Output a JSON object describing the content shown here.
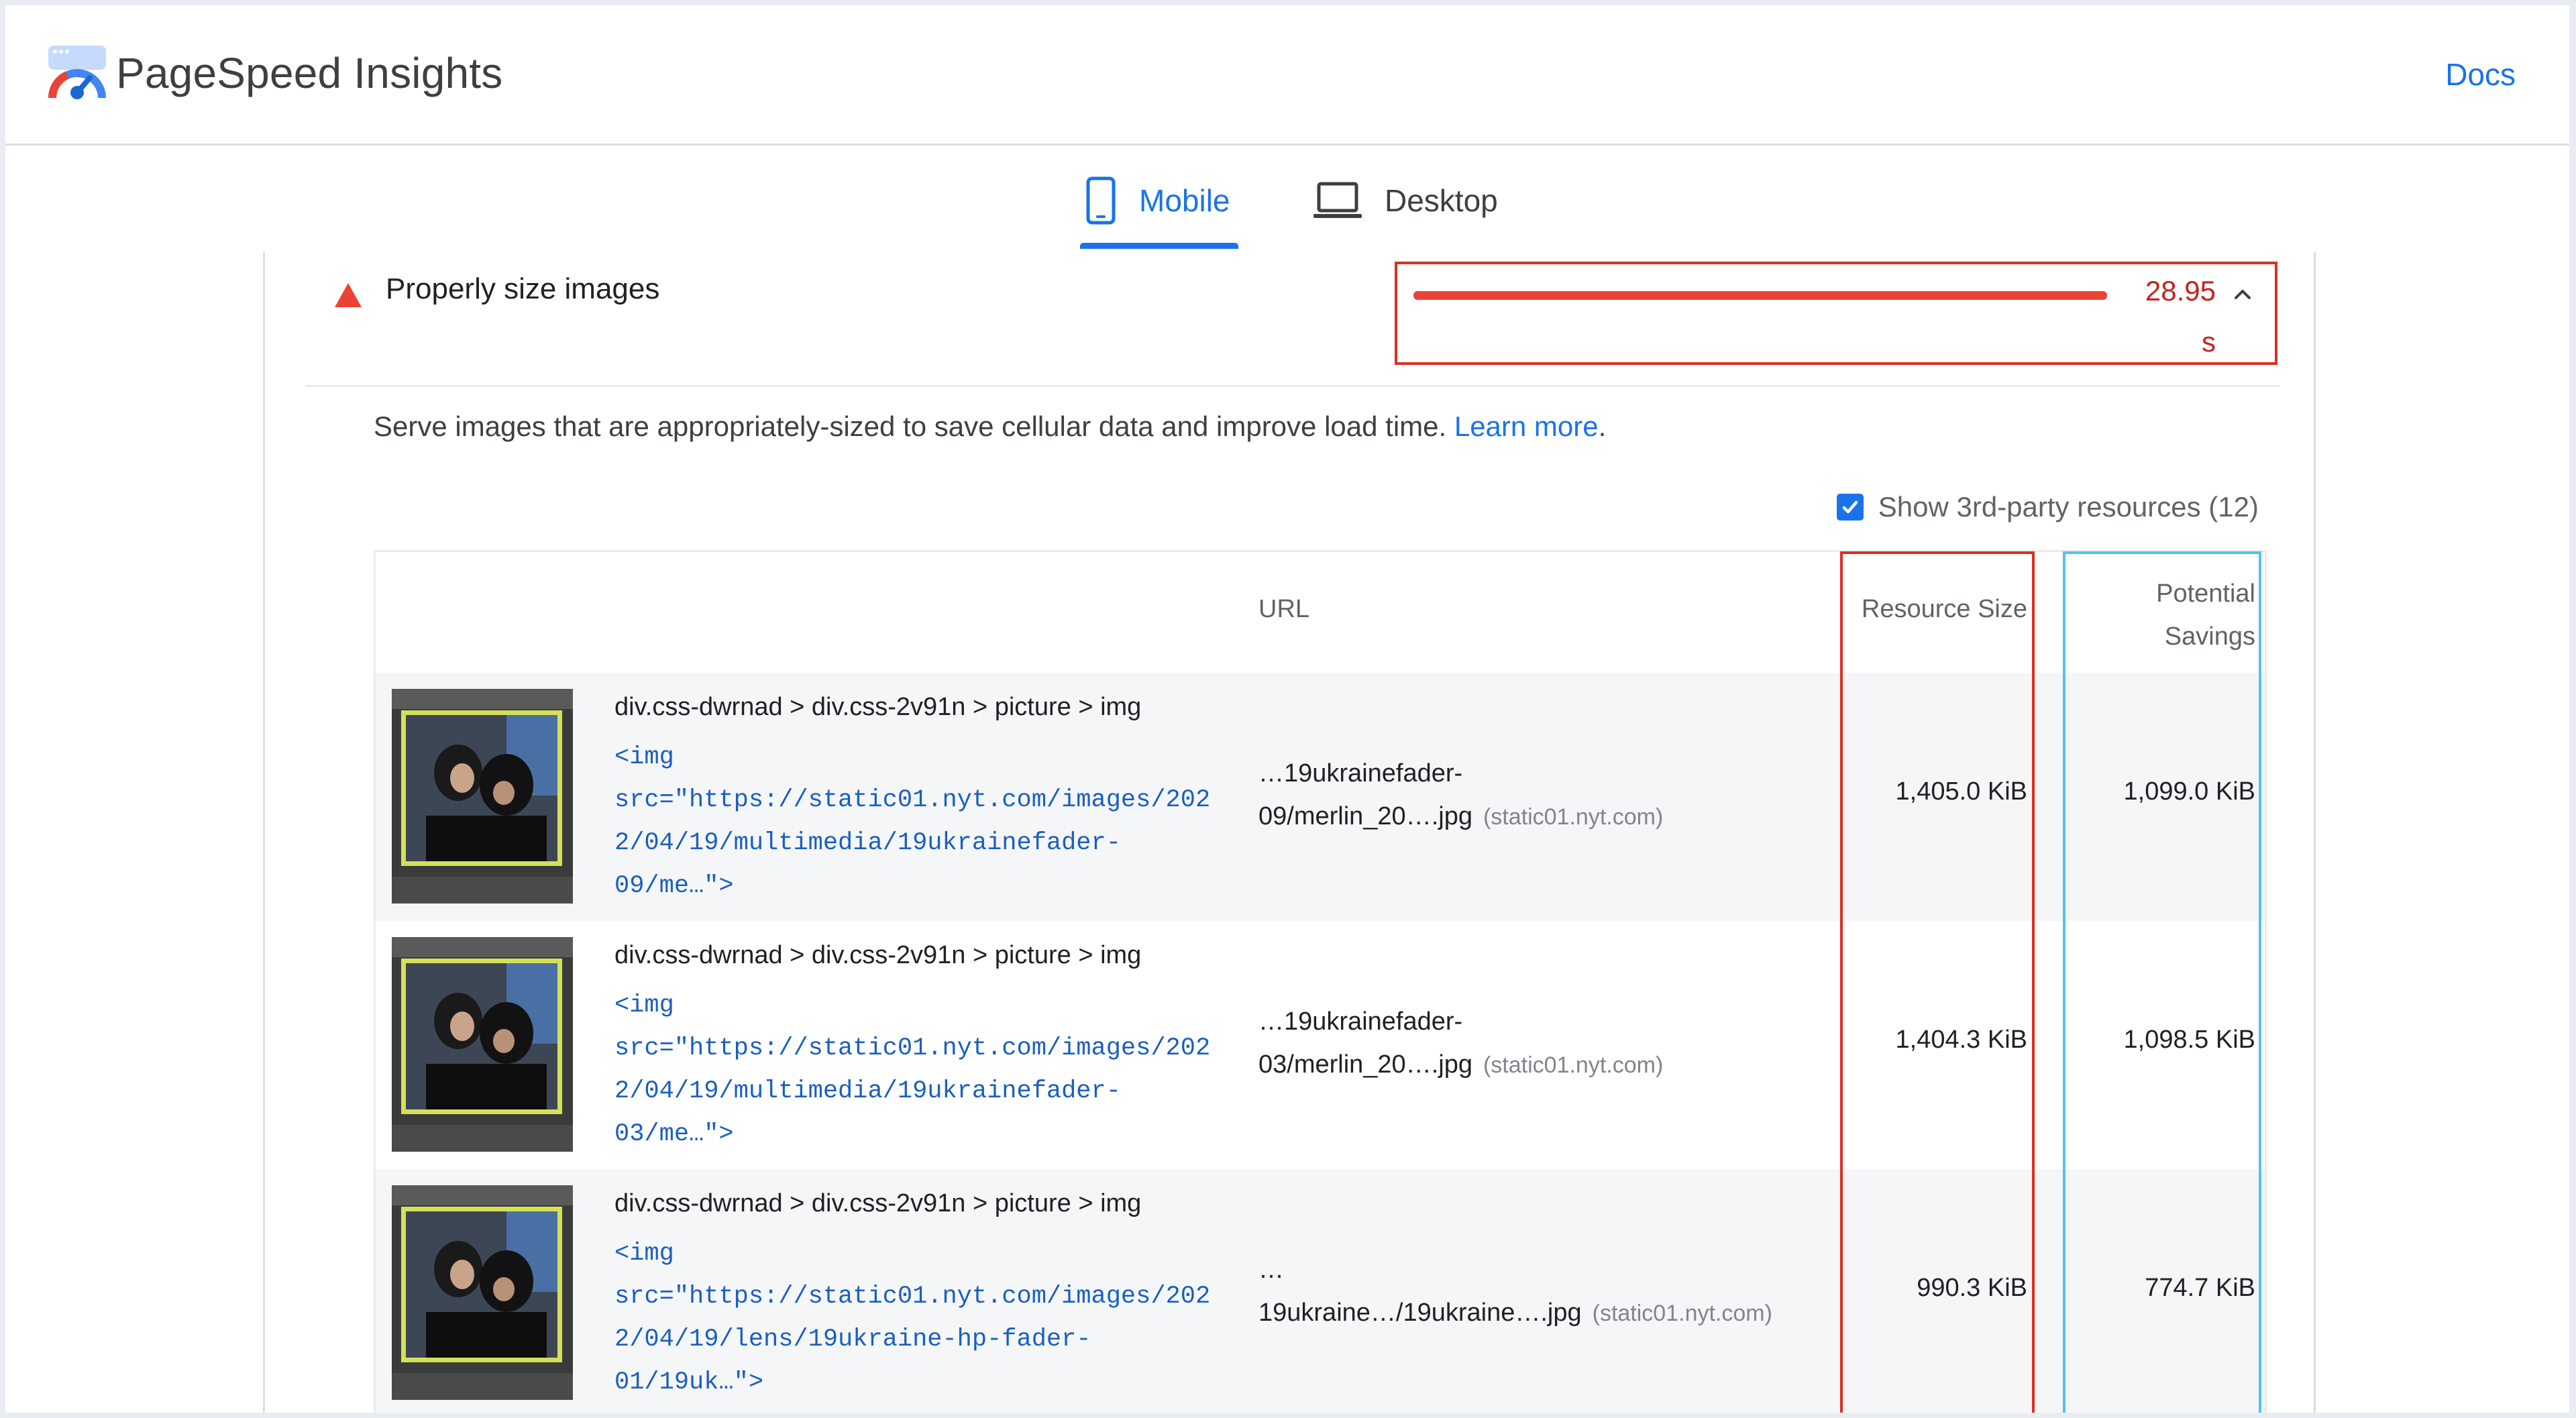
{
  "header": {
    "title": "PageSpeed Insights",
    "docs_label": "Docs"
  },
  "tabs": [
    {
      "label": "Mobile",
      "selected": true
    },
    {
      "label": "Desktop",
      "selected": false
    }
  ],
  "audit": {
    "title": "Properly size images",
    "status_color": "#ea4335",
    "savings_value": "28.95",
    "savings_unit": "s",
    "description": "Serve images that are appropriately-sized to save cellular data and improve load time.",
    "learn_more": "Learn more",
    "period": "."
  },
  "third_party": {
    "label": "Show 3rd-party resources (12)",
    "checked": true
  },
  "table": {
    "columns": {
      "url": "URL",
      "resource_size": "Resource Size",
      "potential_savings_line1": "Potential",
      "potential_savings_line2": "Savings"
    },
    "rows": [
      {
        "node_path": "div.css-dwrnad > div.css-2v91n > picture > img",
        "code": "<img\nsrc=\"https://static01.nyt.com/images/202\n2/04/19/multimedia/19ukrainefader-\n09/me…\">",
        "url_line1": "…19ukrainefader-",
        "url_line2": "09/merlin_20….jpg",
        "host": "(static01.nyt.com)",
        "resource_size": "1,405.0 KiB",
        "potential_savings": "1,099.0 KiB"
      },
      {
        "node_path": "div.css-dwrnad > div.css-2v91n > picture > img",
        "code": "<img\nsrc=\"https://static01.nyt.com/images/202\n2/04/19/multimedia/19ukrainefader-\n03/me…\">",
        "url_line1": "…19ukrainefader-",
        "url_line2": "03/merlin_20….jpg",
        "host": "(static01.nyt.com)",
        "resource_size": "1,404.3 KiB",
        "potential_savings": "1,098.5 KiB"
      },
      {
        "node_path": "div.css-dwrnad > div.css-2v91n > picture > img",
        "code": "<img\nsrc=\"https://static01.nyt.com/images/202\n2/04/19/lens/19ukraine-hp-fader-\n01/19uk…\">",
        "url_line1": "…",
        "url_line2": "19ukraine…/19ukraine….jpg",
        "host": "(static01.nyt.com)",
        "resource_size": "990.3 KiB",
        "potential_savings": "774.7 KiB"
      }
    ]
  }
}
